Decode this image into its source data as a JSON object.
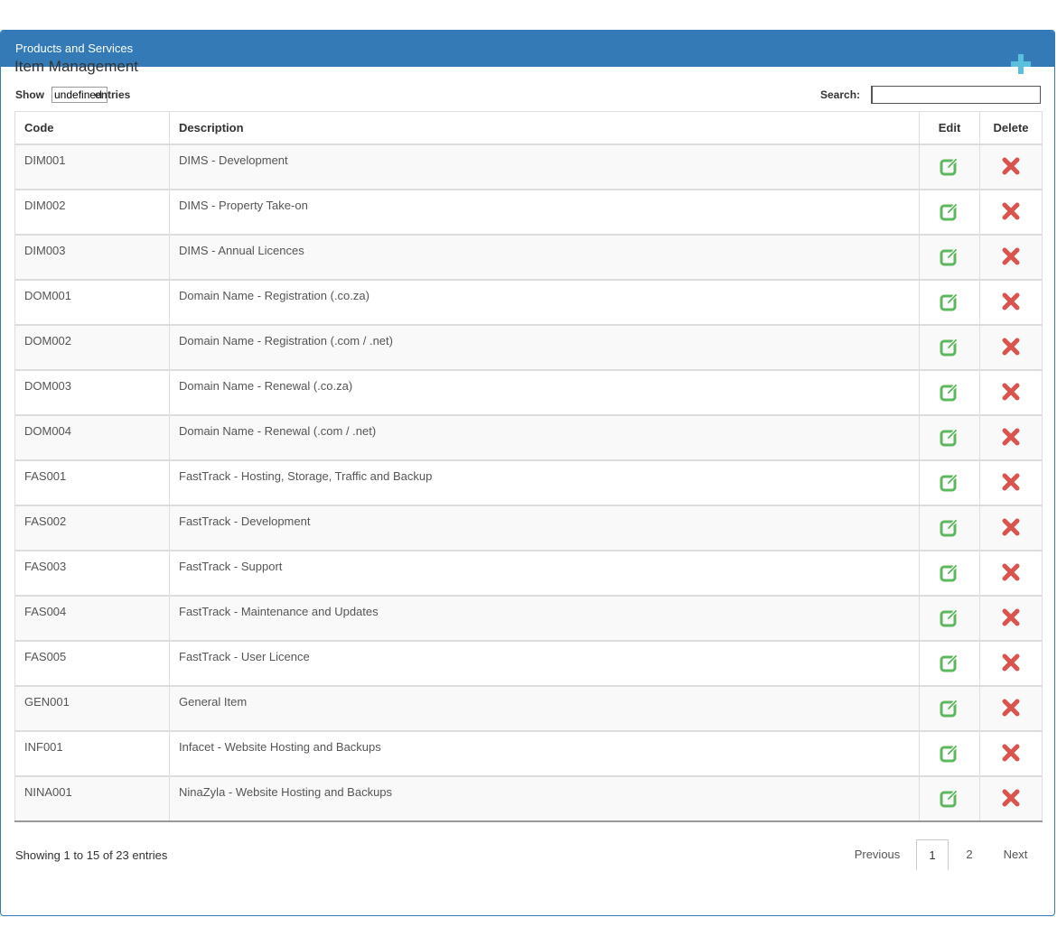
{
  "panel": {
    "heading": "Products and Services"
  },
  "page": {
    "title": "Item Management"
  },
  "controls": {
    "show_label": "Show",
    "length_value": "undefined",
    "entries_label": "entries",
    "search_label": "Search:",
    "search_value": ""
  },
  "table": {
    "headers": {
      "code": "Code",
      "description": "Description",
      "edit": "Edit",
      "delete": "Delete"
    },
    "rows": [
      {
        "code": "DIM001",
        "description": "DIMS - Development"
      },
      {
        "code": "DIM002",
        "description": "DIMS - Property Take-on"
      },
      {
        "code": "DIM003",
        "description": "DIMS - Annual Licences"
      },
      {
        "code": "DOM001",
        "description": "Domain Name - Registration (.co.za)"
      },
      {
        "code": "DOM002",
        "description": "Domain Name - Registration (.com / .net)"
      },
      {
        "code": "DOM003",
        "description": "Domain Name - Renewal (.co.za)"
      },
      {
        "code": "DOM004",
        "description": "Domain Name - Renewal (.com / .net)"
      },
      {
        "code": "FAS001",
        "description": "FastTrack - Hosting, Storage, Traffic and Backup"
      },
      {
        "code": "FAS002",
        "description": "FastTrack - Development"
      },
      {
        "code": "FAS003",
        "description": "FastTrack - Support"
      },
      {
        "code": "FAS004",
        "description": "FastTrack - Maintenance and Updates"
      },
      {
        "code": "FAS005",
        "description": "FastTrack - User Licence"
      },
      {
        "code": "GEN001",
        "description": "General Item"
      },
      {
        "code": "INF001",
        "description": "Infacet - Website Hosting and Backups"
      },
      {
        "code": "NINA001",
        "description": "NinaZyla - Website Hosting and Backups"
      }
    ]
  },
  "footer": {
    "info": "Showing 1 to 15 of 23 entries",
    "pagination": {
      "previous": "Previous",
      "page1": "1",
      "page2": "2",
      "next": "Next"
    }
  },
  "icons": {
    "add": "plus-icon",
    "edit": "edit-icon",
    "delete": "close-icon"
  },
  "colors": {
    "primary": "#337ab7",
    "add": "#5bc0de",
    "edit": "#5cb85c",
    "delete": "#d9534f"
  }
}
